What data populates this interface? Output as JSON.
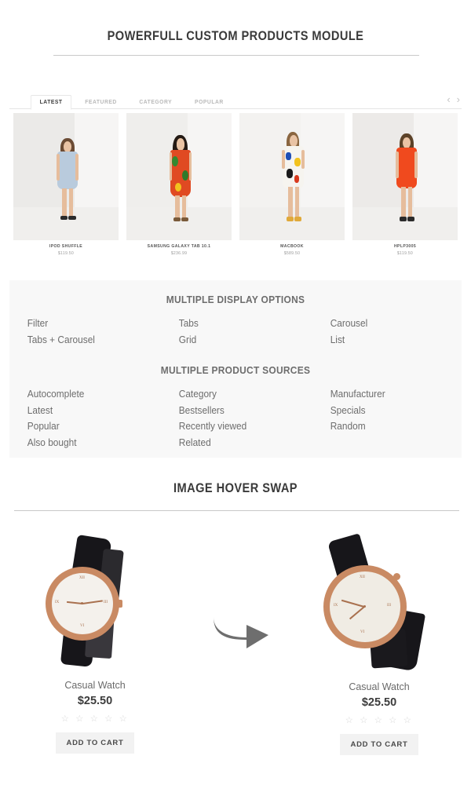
{
  "sections": {
    "module_title": "POWERFULL CUSTOM PRODUCTS MODULE",
    "hover_title": "IMAGE HOVER SWAP"
  },
  "carousel": {
    "tabs": [
      {
        "label": "LATEST",
        "active": true
      },
      {
        "label": "FEATURED",
        "active": false
      },
      {
        "label": "CATEGORY",
        "active": false
      },
      {
        "label": "POPULAR",
        "active": false
      }
    ],
    "nav": {
      "prev": "‹",
      "next": "›"
    },
    "products": [
      {
        "name": "IPOD SHUFFLE",
        "price": "$119.50"
      },
      {
        "name": "SAMSUNG GALAXY TAB 10.1",
        "price": "$236.99"
      },
      {
        "name": "MACBOOK",
        "price": "$589.50"
      },
      {
        "name": "HPLP3005",
        "price": "$119.50"
      }
    ]
  },
  "display_options": {
    "heading": "MULTIPLE DISPLAY OPTIONS",
    "col1": [
      "Filter",
      "Tabs + Carousel"
    ],
    "col2": [
      "Tabs",
      "Grid"
    ],
    "col3": [
      "Carousel",
      "List"
    ]
  },
  "product_sources": {
    "heading": "MULTIPLE PRODUCT SOURCES",
    "col1": [
      "Autocomplete",
      "Latest",
      "Popular",
      "Also bought"
    ],
    "col2": [
      "Category",
      "Bestsellers",
      "Recently viewed",
      "Related"
    ],
    "col3": [
      "Manufacturer",
      "Specials",
      "Random"
    ]
  },
  "hover_swap": {
    "cards": [
      {
        "name": "Casual Watch",
        "price": "$25.50",
        "rating": "☆ ☆ ☆ ☆ ☆",
        "button": "ADD TO CART"
      },
      {
        "name": "Casual Watch",
        "price": "$25.50",
        "rating": "☆ ☆ ☆ ☆ ☆",
        "button": "ADD TO CART"
      }
    ],
    "arrow_icon": "curved-arrow-right"
  },
  "colors": {
    "text_dark": "#3a3a3a",
    "text_muted": "#6d6d6d",
    "panel_bg": "#f8f8f8",
    "rule": "#c9c9c9",
    "button_bg": "#f2f2f2"
  }
}
